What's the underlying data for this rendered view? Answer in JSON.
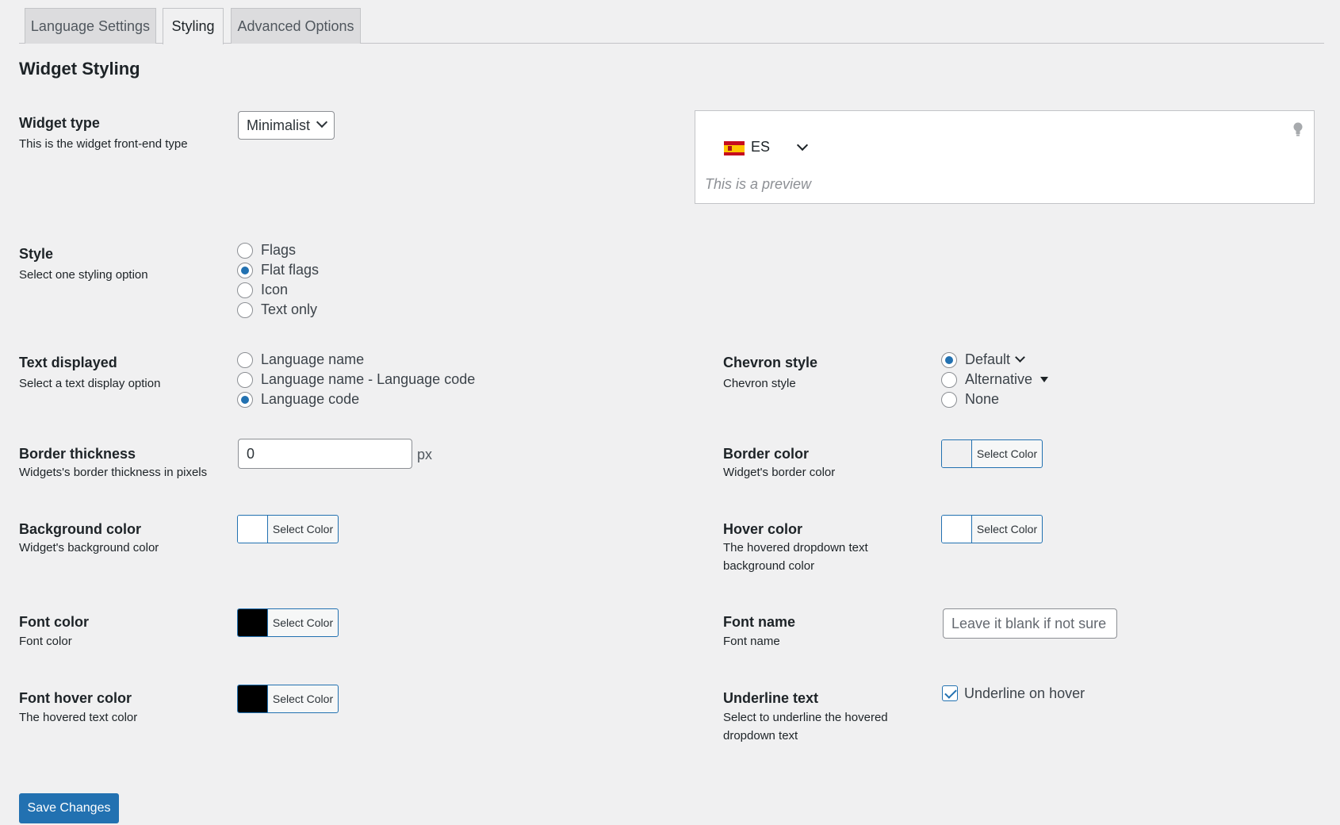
{
  "tabs": [
    {
      "label": "Language Settings",
      "active": false
    },
    {
      "label": "Styling",
      "active": true
    },
    {
      "label": "Advanced Options",
      "active": false
    }
  ],
  "page_title": "Widget Styling",
  "widget_type": {
    "label": "Widget type",
    "desc": "This is the widget front-end type",
    "selected": "Minimalist"
  },
  "preview": {
    "flag_icon": "spain-flag-icon",
    "code": "ES",
    "note": "This is a preview"
  },
  "style": {
    "label": "Style",
    "desc": "Select one styling option",
    "options": [
      "Flags",
      "Flat flags",
      "Icon",
      "Text only"
    ],
    "selected": "Flat flags"
  },
  "text_displayed": {
    "label": "Text displayed",
    "desc": "Select a text display option",
    "options": [
      "Language name",
      "Language name - Language code",
      "Language code"
    ],
    "selected": "Language code"
  },
  "chevron_style": {
    "label": "Chevron style",
    "desc": "Chevron style",
    "options": [
      "Default",
      "Alternative",
      "None"
    ],
    "selected": "Default"
  },
  "border_thickness": {
    "label": "Border thickness",
    "desc": "Widgets's border thickness in pixels",
    "value": "0",
    "unit": "px"
  },
  "border_color": {
    "label": "Border color",
    "desc": "Widget's border color",
    "button": "Select Color",
    "swatch": "#f0f0f1"
  },
  "background_color": {
    "label": "Background color",
    "desc": "Widget's background color",
    "button": "Select Color",
    "swatch": "#ffffff"
  },
  "hover_color": {
    "label": "Hover color",
    "desc": "The hovered dropdown text background color",
    "button": "Select Color",
    "swatch": "#ffffff"
  },
  "font_color": {
    "label": "Font color",
    "desc": "Font color",
    "button": "Select Color",
    "swatch": "#000000"
  },
  "font_name": {
    "label": "Font name",
    "desc": "Font name",
    "placeholder": "Leave it blank if not sure"
  },
  "font_hover_color": {
    "label": "Font hover color",
    "desc": "The hovered text color",
    "button": "Select Color",
    "swatch": "#000000"
  },
  "underline_text": {
    "label": "Underline text",
    "desc": "Select to underline the hovered dropdown text",
    "checkbox_label": "Underline on hover",
    "checked": true
  },
  "save_label": "Save Changes",
  "colors": {
    "accent": "#2271b1",
    "background": "#f0f0f1"
  }
}
